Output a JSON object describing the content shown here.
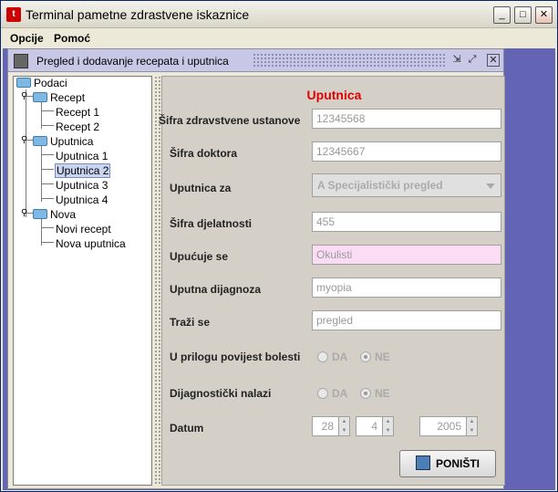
{
  "window": {
    "title": "Terminal pametne zdrastvene iskaznice"
  },
  "menu": {
    "items": [
      "Opcije",
      "Pomoć"
    ]
  },
  "inner_frame": {
    "title": "Pregled i dodavanje recepata i uputnica"
  },
  "tree": {
    "root": "Podaci",
    "nodes": [
      {
        "label": "Recept",
        "children": [
          "Recept 1",
          "Recept 2"
        ]
      },
      {
        "label": "Uputnica",
        "children": [
          "Uputnica 1",
          "Uputnica 2",
          "Uputnica 3",
          "Uputnica 4"
        ]
      },
      {
        "label": "Nova",
        "children": [
          "Novi recept",
          "Nova uputnica"
        ]
      }
    ],
    "selected": "Uputnica 2"
  },
  "form": {
    "title": "Uputnica",
    "sifra_ustanove": {
      "label": "Šifra zdravstvene ustanove",
      "value": "12345568"
    },
    "sifra_doktora": {
      "label": "Šifra doktora",
      "value": "12345667"
    },
    "uputnica_za": {
      "label": "Uputnica za",
      "value": "A Specijalistički pregled"
    },
    "sifra_djelatnosti": {
      "label": "Šifra djelatnosti",
      "value": "455"
    },
    "upucuje_se": {
      "label": "Upućuje se",
      "value": "Okulisti"
    },
    "uputna_dijagnoza": {
      "label": "Uputna dijagnoza",
      "value": "myopia"
    },
    "trazi_se": {
      "label": "Traži se",
      "value": "pregled"
    },
    "u_prilogu": {
      "label": "U prilogu povijest bolesti",
      "da": "DA",
      "ne": "NE",
      "selected": "NE"
    },
    "dijagnosticki": {
      "label": "Dijagnostički nalazi",
      "da": "DA",
      "ne": "NE",
      "selected": "NE"
    },
    "datum": {
      "label": "Datum",
      "day": "28",
      "month": "4",
      "year": "2005"
    },
    "ponisti": "PONIŠTI"
  }
}
